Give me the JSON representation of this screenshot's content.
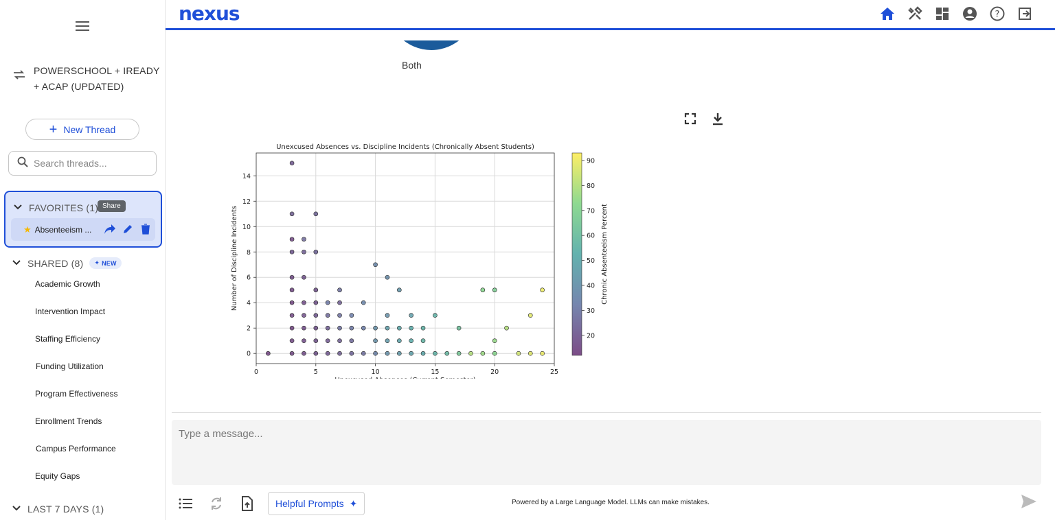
{
  "app": {
    "logo": "nexus"
  },
  "sidebar": {
    "datasource": "POWERSCHOOL + IREADY + ACAP (UPDATED)",
    "new_thread_label": "New Thread",
    "search_placeholder": "Search threads...",
    "favorites": {
      "header": "FAVORITES (1)",
      "items": [
        {
          "label": "Absenteeism ..."
        }
      ],
      "tooltip": "Share"
    },
    "shared": {
      "header": "SHARED (8)",
      "badge": "NEW",
      "items": [
        {
          "label": "Academic Growth"
        },
        {
          "label": "Intervention Impact"
        },
        {
          "label": "Staffing Efficiency"
        },
        {
          "label": "Funding Utilization"
        },
        {
          "label": "Program Effectiveness"
        },
        {
          "label": "Enrollment Trends"
        },
        {
          "label": "Campus Performance"
        },
        {
          "label": "Equity Gaps"
        }
      ]
    },
    "last7": {
      "header": "LAST 7 DAYS (1)"
    }
  },
  "topnav": {
    "icons": [
      "home-icon",
      "tools-icon",
      "dashboard-icon",
      "account-icon",
      "help-icon",
      "logout-icon"
    ],
    "accent": "#1f4fd8"
  },
  "main": {
    "pie_label": "Both",
    "composer_placeholder": "Type a message...",
    "helpful_prompts": "Helpful Prompts",
    "powered_by": "Powered by a Large Language Model. LLMs can make mistakes."
  },
  "chart_data": {
    "type": "scatter",
    "title": "Unexcused Absences vs. Discipline Incidents (Chronically Absent Students)",
    "xlabel": "Unexcused Absences (Current Semester)",
    "ylabel": "Number of Discipline Incidents",
    "colorbar_label": "Chronic Absenteeism Percent",
    "xlim": [
      0,
      25
    ],
    "ylim": [
      -0.8,
      15.8
    ],
    "xticks": [
      0,
      5,
      10,
      15,
      20,
      25
    ],
    "yticks": [
      0,
      2,
      4,
      6,
      8,
      10,
      12,
      14
    ],
    "colorbar_ticks": [
      20,
      30,
      40,
      50,
      60,
      70,
      80,
      90
    ],
    "clim": [
      12,
      93
    ],
    "grid": true,
    "colormap": "viridis",
    "points": [
      [
        1,
        0,
        14
      ],
      [
        3,
        0,
        15
      ],
      [
        4,
        0,
        16
      ],
      [
        5,
        0,
        18
      ],
      [
        6,
        0,
        20
      ],
      [
        7,
        0,
        22
      ],
      [
        8,
        0,
        24
      ],
      [
        9,
        0,
        27
      ],
      [
        10,
        0,
        34
      ],
      [
        11,
        0,
        40
      ],
      [
        12,
        0,
        44
      ],
      [
        13,
        0,
        47
      ],
      [
        14,
        0,
        50
      ],
      [
        15,
        0,
        55
      ],
      [
        16,
        0,
        58
      ],
      [
        17,
        0,
        65
      ],
      [
        18,
        0,
        80
      ],
      [
        19,
        0,
        76
      ],
      [
        20,
        0,
        72
      ],
      [
        22,
        0,
        85
      ],
      [
        23,
        0,
        88
      ],
      [
        24,
        0,
        90
      ],
      [
        3,
        1,
        15
      ],
      [
        4,
        1,
        16
      ],
      [
        5,
        1,
        18
      ],
      [
        6,
        1,
        20
      ],
      [
        7,
        1,
        22
      ],
      [
        8,
        1,
        25
      ],
      [
        10,
        1,
        40
      ],
      [
        11,
        1,
        44
      ],
      [
        12,
        1,
        48
      ],
      [
        13,
        1,
        52
      ],
      [
        14,
        1,
        56
      ],
      [
        20,
        1,
        75
      ],
      [
        3,
        2,
        14
      ],
      [
        4,
        2,
        16
      ],
      [
        5,
        2,
        18
      ],
      [
        6,
        2,
        22
      ],
      [
        7,
        2,
        28
      ],
      [
        8,
        2,
        30
      ],
      [
        9,
        2,
        32
      ],
      [
        10,
        2,
        40
      ],
      [
        11,
        2,
        46
      ],
      [
        12,
        2,
        50
      ],
      [
        13,
        2,
        52
      ],
      [
        14,
        2,
        55
      ],
      [
        17,
        2,
        62
      ],
      [
        21,
        2,
        80
      ],
      [
        3,
        3,
        15
      ],
      [
        4,
        3,
        17
      ],
      [
        5,
        3,
        20
      ],
      [
        6,
        3,
        25
      ],
      [
        7,
        3,
        28
      ],
      [
        8,
        3,
        32
      ],
      [
        11,
        3,
        40
      ],
      [
        13,
        3,
        46
      ],
      [
        15,
        3,
        55
      ],
      [
        23,
        3,
        88
      ],
      [
        3,
        4,
        14
      ],
      [
        4,
        4,
        16
      ],
      [
        5,
        4,
        18
      ],
      [
        6,
        4,
        30
      ],
      [
        7,
        4,
        22
      ],
      [
        9,
        4,
        35
      ],
      [
        3,
        5,
        15
      ],
      [
        5,
        5,
        18
      ],
      [
        7,
        5,
        28
      ],
      [
        12,
        5,
        42
      ],
      [
        19,
        5,
        72
      ],
      [
        20,
        5,
        68
      ],
      [
        24,
        5,
        90
      ],
      [
        3,
        6,
        16
      ],
      [
        4,
        6,
        18
      ],
      [
        11,
        6,
        38
      ],
      [
        10,
        7,
        36
      ],
      [
        3,
        8,
        20
      ],
      [
        4,
        8,
        22
      ],
      [
        5,
        8,
        24
      ],
      [
        3,
        9,
        15
      ],
      [
        4,
        9,
        25
      ],
      [
        3,
        11,
        22
      ],
      [
        5,
        11,
        24
      ],
      [
        3,
        15,
        20
      ]
    ]
  }
}
